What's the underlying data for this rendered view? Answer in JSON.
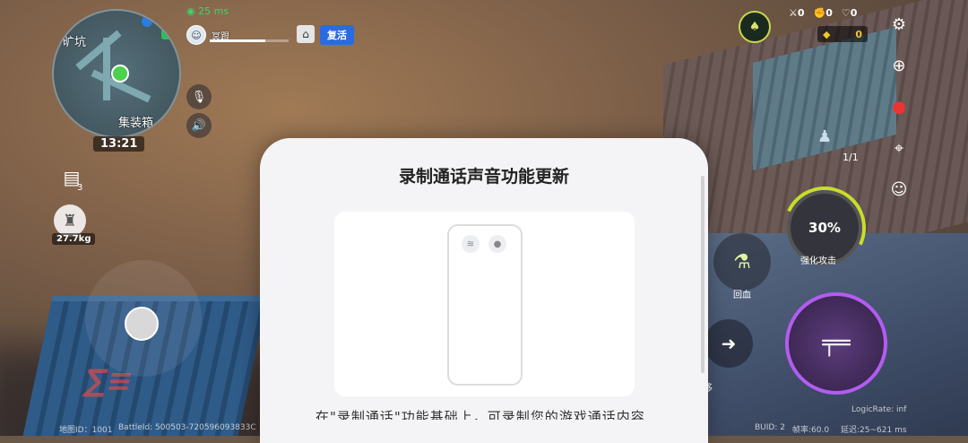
{
  "minimap": {
    "location_label": "旷坑",
    "poi_label": "集装箱",
    "time": "13:21"
  },
  "network": {
    "ping": "25 ms"
  },
  "player": {
    "name": "冥跟",
    "hp_fraction": 0.7
  },
  "revive_button": {
    "label": "复活"
  },
  "left_hud": {
    "ammo_count": "3",
    "weight": "27.7kg"
  },
  "top_right": {
    "kills": "0",
    "assists": "0",
    "shields": "0",
    "coins": "0"
  },
  "right_hud": {
    "ally_count": "1/1",
    "boost_percent": "30%",
    "boost_label": "强化攻击",
    "heal_label": "回血",
    "move_label": "移"
  },
  "dialog": {
    "title": "录制通话声音功能更新",
    "subtitle_partial": "在\"录制通话\"功能基础上，可录制您的游戏通话内容"
  },
  "bottom_info": {
    "map_id": "地图ID：1001",
    "battle_id": "BattleId: 500503-720596093833C",
    "logic_rate": "LogicRate: inf",
    "buid": "BUID:  2",
    "frame_rate": "帧率:60.0",
    "latency": "延迟:25~621 ms"
  }
}
